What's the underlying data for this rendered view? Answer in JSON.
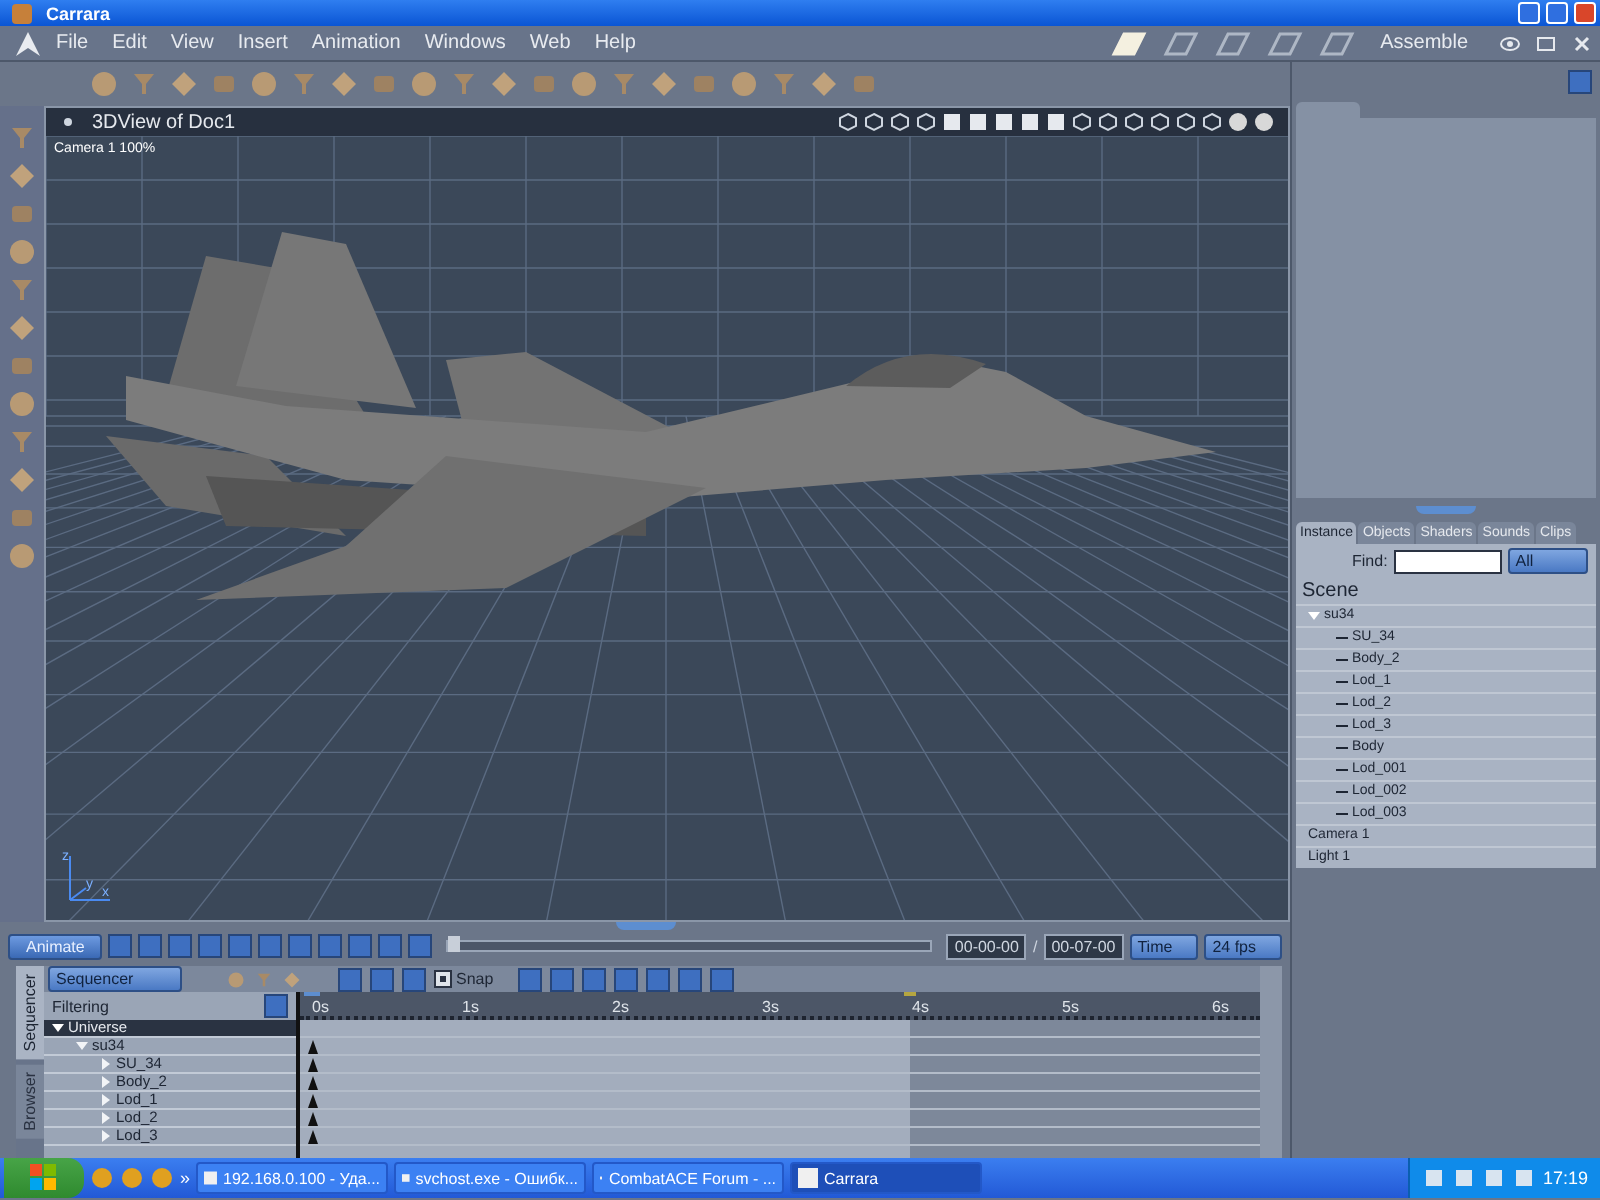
{
  "window": {
    "title": "Carrara"
  },
  "menu": [
    "File",
    "Edit",
    "View",
    "Insert",
    "Animation",
    "Windows",
    "Web",
    "Help"
  ],
  "rooms": {
    "label": "Assemble",
    "items": [
      {
        "selected": true
      },
      {
        "selected": false
      },
      {
        "selected": false
      },
      {
        "selected": false
      },
      {
        "selected": false
      }
    ]
  },
  "viewport": {
    "title": "3DView of Doc1",
    "camera_label": "Camera 1 100%",
    "axis_labels": [
      "z",
      "y",
      "x"
    ]
  },
  "right_panel": {
    "tabs": [
      {
        "label": "Instance",
        "selected": true
      },
      {
        "label": "Objects",
        "selected": false
      },
      {
        "label": "Shaders",
        "selected": false
      },
      {
        "label": "Sounds",
        "selected": false
      },
      {
        "label": "Clips",
        "selected": false
      }
    ],
    "find_label": "Find:",
    "filter": "All",
    "tree": {
      "title": "Scene",
      "items": [
        {
          "label": "su34",
          "expanded": true,
          "children": [
            {
              "label": "SU_34"
            },
            {
              "label": "Body_2"
            },
            {
              "label": "Lod_1"
            },
            {
              "label": "Lod_2"
            },
            {
              "label": "Lod_3"
            },
            {
              "label": "Body"
            },
            {
              "label": "Lod_001"
            },
            {
              "label": "Lod_002"
            },
            {
              "label": "Lod_003"
            }
          ]
        },
        {
          "label": "Camera 1"
        },
        {
          "label": "Light 1"
        }
      ]
    }
  },
  "animation_bar": {
    "button": "Animate",
    "scrubber": {
      "level": 0
    },
    "current_time": "00-00-00",
    "separator": "/",
    "end_time": "00-07-00",
    "time_mode": "Time",
    "frame_rate": "24 fps"
  },
  "sequencer": {
    "side_tabs": [
      {
        "label": "Sequencer",
        "selected": true
      },
      {
        "label": "Browser",
        "selected": false
      }
    ],
    "mode": "Sequencer",
    "filter_label": "Filtering",
    "snap": {
      "label": "Snap",
      "checked": true
    },
    "ruler": [
      "0s",
      "1s",
      "2s",
      "3s",
      "4s",
      "5s",
      "6s"
    ],
    "tree": [
      {
        "label": "Universe",
        "expanded": true,
        "children": [
          {
            "label": "su34",
            "expanded": true,
            "children": [
              {
                "label": "SU_34",
                "expanded": false
              },
              {
                "label": "Body_2",
                "expanded": false
              },
              {
                "label": "Lod_1",
                "expanded": false
              },
              {
                "label": "Lod_2",
                "expanded": false
              },
              {
                "label": "Lod_3",
                "expanded": false
              }
            ]
          }
        ]
      }
    ]
  },
  "taskbar": {
    "more": "»",
    "tasks": [
      {
        "label": "192.168.0.100 - Уда...",
        "selected": false
      },
      {
        "label": "svchost.exe - Ошибк...",
        "selected": false
      },
      {
        "label": "CombatACE Forum - ...",
        "selected": false
      },
      {
        "label": "Carrara",
        "selected": true
      }
    ],
    "clock": "17:19"
  }
}
